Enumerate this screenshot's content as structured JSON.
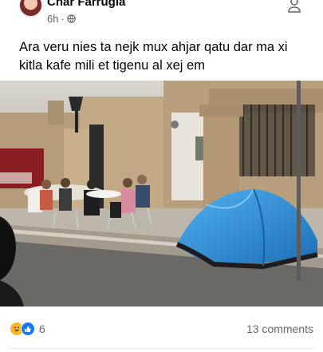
{
  "post": {
    "author": "Char Farrugia",
    "time": "6h",
    "separator": "·",
    "text": "Ara veru nies ta nejk mux ahjar qatu dar ma xi kitla kafe mili et tigenu al xej em"
  },
  "footer": {
    "reaction_count": "6",
    "comments": "13 comments"
  },
  "icons": {
    "privacy": "globe-icon",
    "options": "person-icon",
    "reactions": [
      "haha-icon",
      "like-icon"
    ]
  },
  "colors": {
    "accent": "#1877f2",
    "secondary_text": "#65676b",
    "tent": "#2f8fd8"
  }
}
